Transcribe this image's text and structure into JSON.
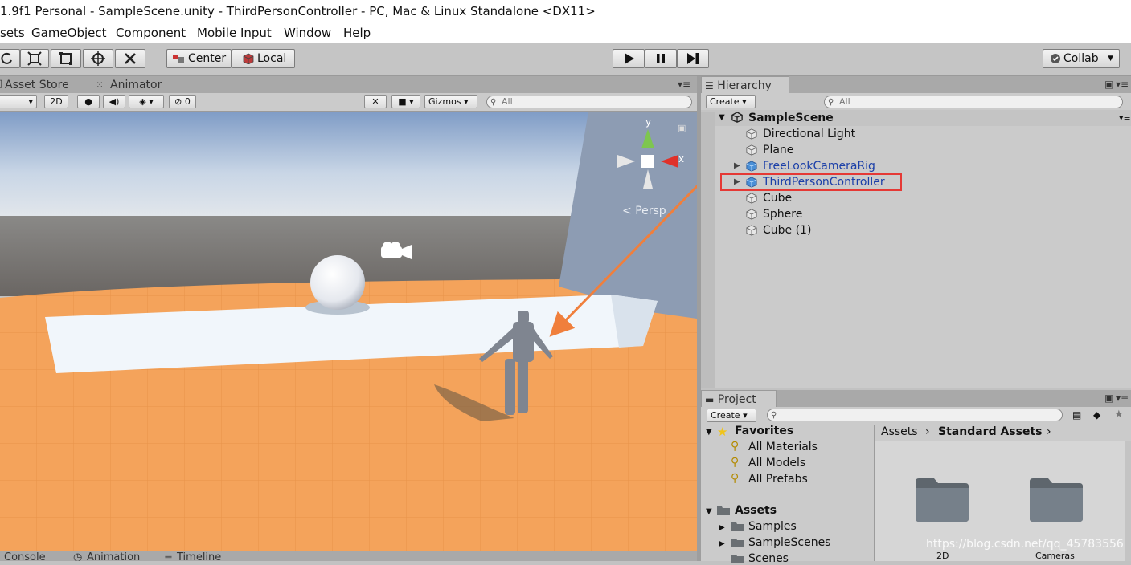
{
  "window": {
    "title": "1.9f1 Personal - SampleScene.unity - ThirdPersonController - PC, Mac & Linux Standalone <DX11>"
  },
  "menu": [
    "sets",
    "GameObject",
    "Component",
    "Mobile Input",
    "Window",
    "Help"
  ],
  "toolbar": {
    "pivot_label": "Center",
    "space_label": "Local",
    "collab_label": "Collab"
  },
  "scene": {
    "tabs": [
      "Asset Store",
      "Animator"
    ],
    "btn_2d": "2D",
    "hidden_count": "0",
    "gizmos_label": "Gizmos",
    "search_placeholder": "All",
    "persp_label": "Persp",
    "axis_y": "y",
    "axis_x": "x"
  },
  "hierarchy": {
    "tab_label": "Hierarchy",
    "create_label": "Create",
    "search_placeholder": "All",
    "scene_name": "SampleScene",
    "items": [
      {
        "name": "Directional Light",
        "prefab": false
      },
      {
        "name": "Plane",
        "prefab": false
      },
      {
        "name": "FreeLookCameraRig",
        "prefab": true
      },
      {
        "name": "ThirdPersonController",
        "prefab": true,
        "selected_highlight": "#e53935"
      },
      {
        "name": "Cube",
        "prefab": false
      },
      {
        "name": "Sphere",
        "prefab": false
      },
      {
        "name": "Cube (1)",
        "prefab": false
      }
    ]
  },
  "project": {
    "tab_label": "Project",
    "create_label": "Create",
    "favorites_label": "Favorites",
    "favorites": [
      "All Materials",
      "All Models",
      "All Prefabs"
    ],
    "assets_label": "Assets",
    "assets_children": [
      "Samples",
      "SampleScenes",
      "Scenes"
    ],
    "breadcrumb": [
      "Assets",
      "Standard Assets"
    ],
    "folders": [
      "2D",
      "Cameras"
    ]
  },
  "bottom_tabs": [
    "Console",
    "Animation",
    "Timeline"
  ],
  "watermark": "https://blog.csdn.net/qq_45783556",
  "colors": {
    "accent_arrow": "#f07f3c",
    "highlight_box": "#e53935",
    "prefab_text": "#1b3fa8"
  }
}
